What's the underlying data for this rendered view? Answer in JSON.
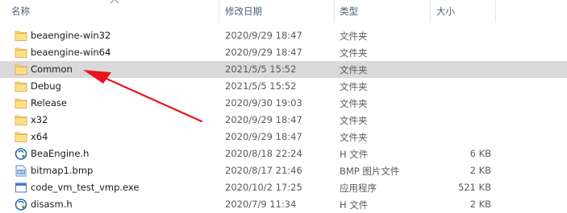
{
  "columns": {
    "name": "名称",
    "date": "修改日期",
    "type": "类型",
    "size": "大小"
  },
  "files": [
    {
      "name": "beaengine-win32",
      "date": "2020/9/29 18:47",
      "type": "文件夹",
      "size": "",
      "icon": "folder-icon"
    },
    {
      "name": "beaengine-win64",
      "date": "2020/9/29 18:47",
      "type": "文件夹",
      "size": "",
      "icon": "folder-icon"
    },
    {
      "name": "Common",
      "date": "2021/5/5 15:52",
      "type": "文件夹",
      "size": "",
      "icon": "folder-icon",
      "selected": true
    },
    {
      "name": "Debug",
      "date": "2021/5/5 15:52",
      "type": "文件夹",
      "size": "",
      "icon": "folder-icon"
    },
    {
      "name": "Release",
      "date": "2020/9/30 19:03",
      "type": "文件夹",
      "size": "",
      "icon": "folder-icon"
    },
    {
      "name": "x32",
      "date": "2020/9/29 18:47",
      "type": "文件夹",
      "size": "",
      "icon": "folder-icon"
    },
    {
      "name": "x64",
      "date": "2020/9/29 18:47",
      "type": "文件夹",
      "size": "",
      "icon": "folder-icon"
    },
    {
      "name": "BeaEngine.h",
      "date": "2020/8/18 22:24",
      "type": "H 文件",
      "size": "6 KB",
      "icon": "header-file-icon"
    },
    {
      "name": "bitmap1.bmp",
      "date": "2020/8/17 21:46",
      "type": "BMP 图片文件",
      "size": "2 KB",
      "icon": "bitmap-file-icon"
    },
    {
      "name": "code_vm_test_vmp.exe",
      "date": "2020/10/2 17:25",
      "type": "应用程序",
      "size": "521 KB",
      "icon": "exe-file-icon"
    },
    {
      "name": "disasm.h",
      "date": "2020/7/9 11:34",
      "type": "H 文件",
      "size": "2 KB",
      "icon": "header-file-icon"
    }
  ],
  "colors": {
    "folder": "#f8d775",
    "selection": "#d9d9d9",
    "annotation_arrow": "#e8141e",
    "header_text": "#4c607a"
  }
}
